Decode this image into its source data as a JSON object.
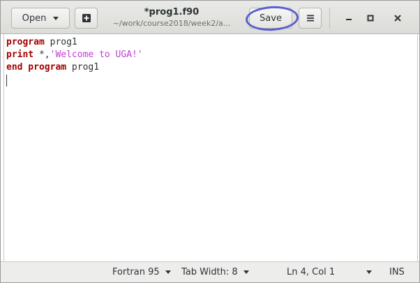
{
  "header": {
    "open_label": "Open",
    "title": "*prog1.f90",
    "subtitle": "~/work/course2018/week2/a...",
    "save_label": "Save"
  },
  "editor": {
    "line1": {
      "keyword": "program",
      "rest": " prog1"
    },
    "line2": {
      "keyword": "print",
      "middle": " *,",
      "string": "'Welcome to UGA!'"
    },
    "line3": {
      "keyword": "end program",
      "rest": " prog1"
    }
  },
  "statusbar": {
    "language": "Fortran 95",
    "tab_width": "Tab Width: 8",
    "position": "Ln 4, Col 1",
    "mode": "INS"
  },
  "colors": {
    "keyword": "#a40000",
    "string": "#c03fd0",
    "annotation_circle": "#5a5fcf"
  },
  "icons": [
    "chevron-down-icon",
    "new-document-icon",
    "hamburger-menu-icon",
    "minimize-icon",
    "maximize-icon",
    "close-icon"
  ]
}
